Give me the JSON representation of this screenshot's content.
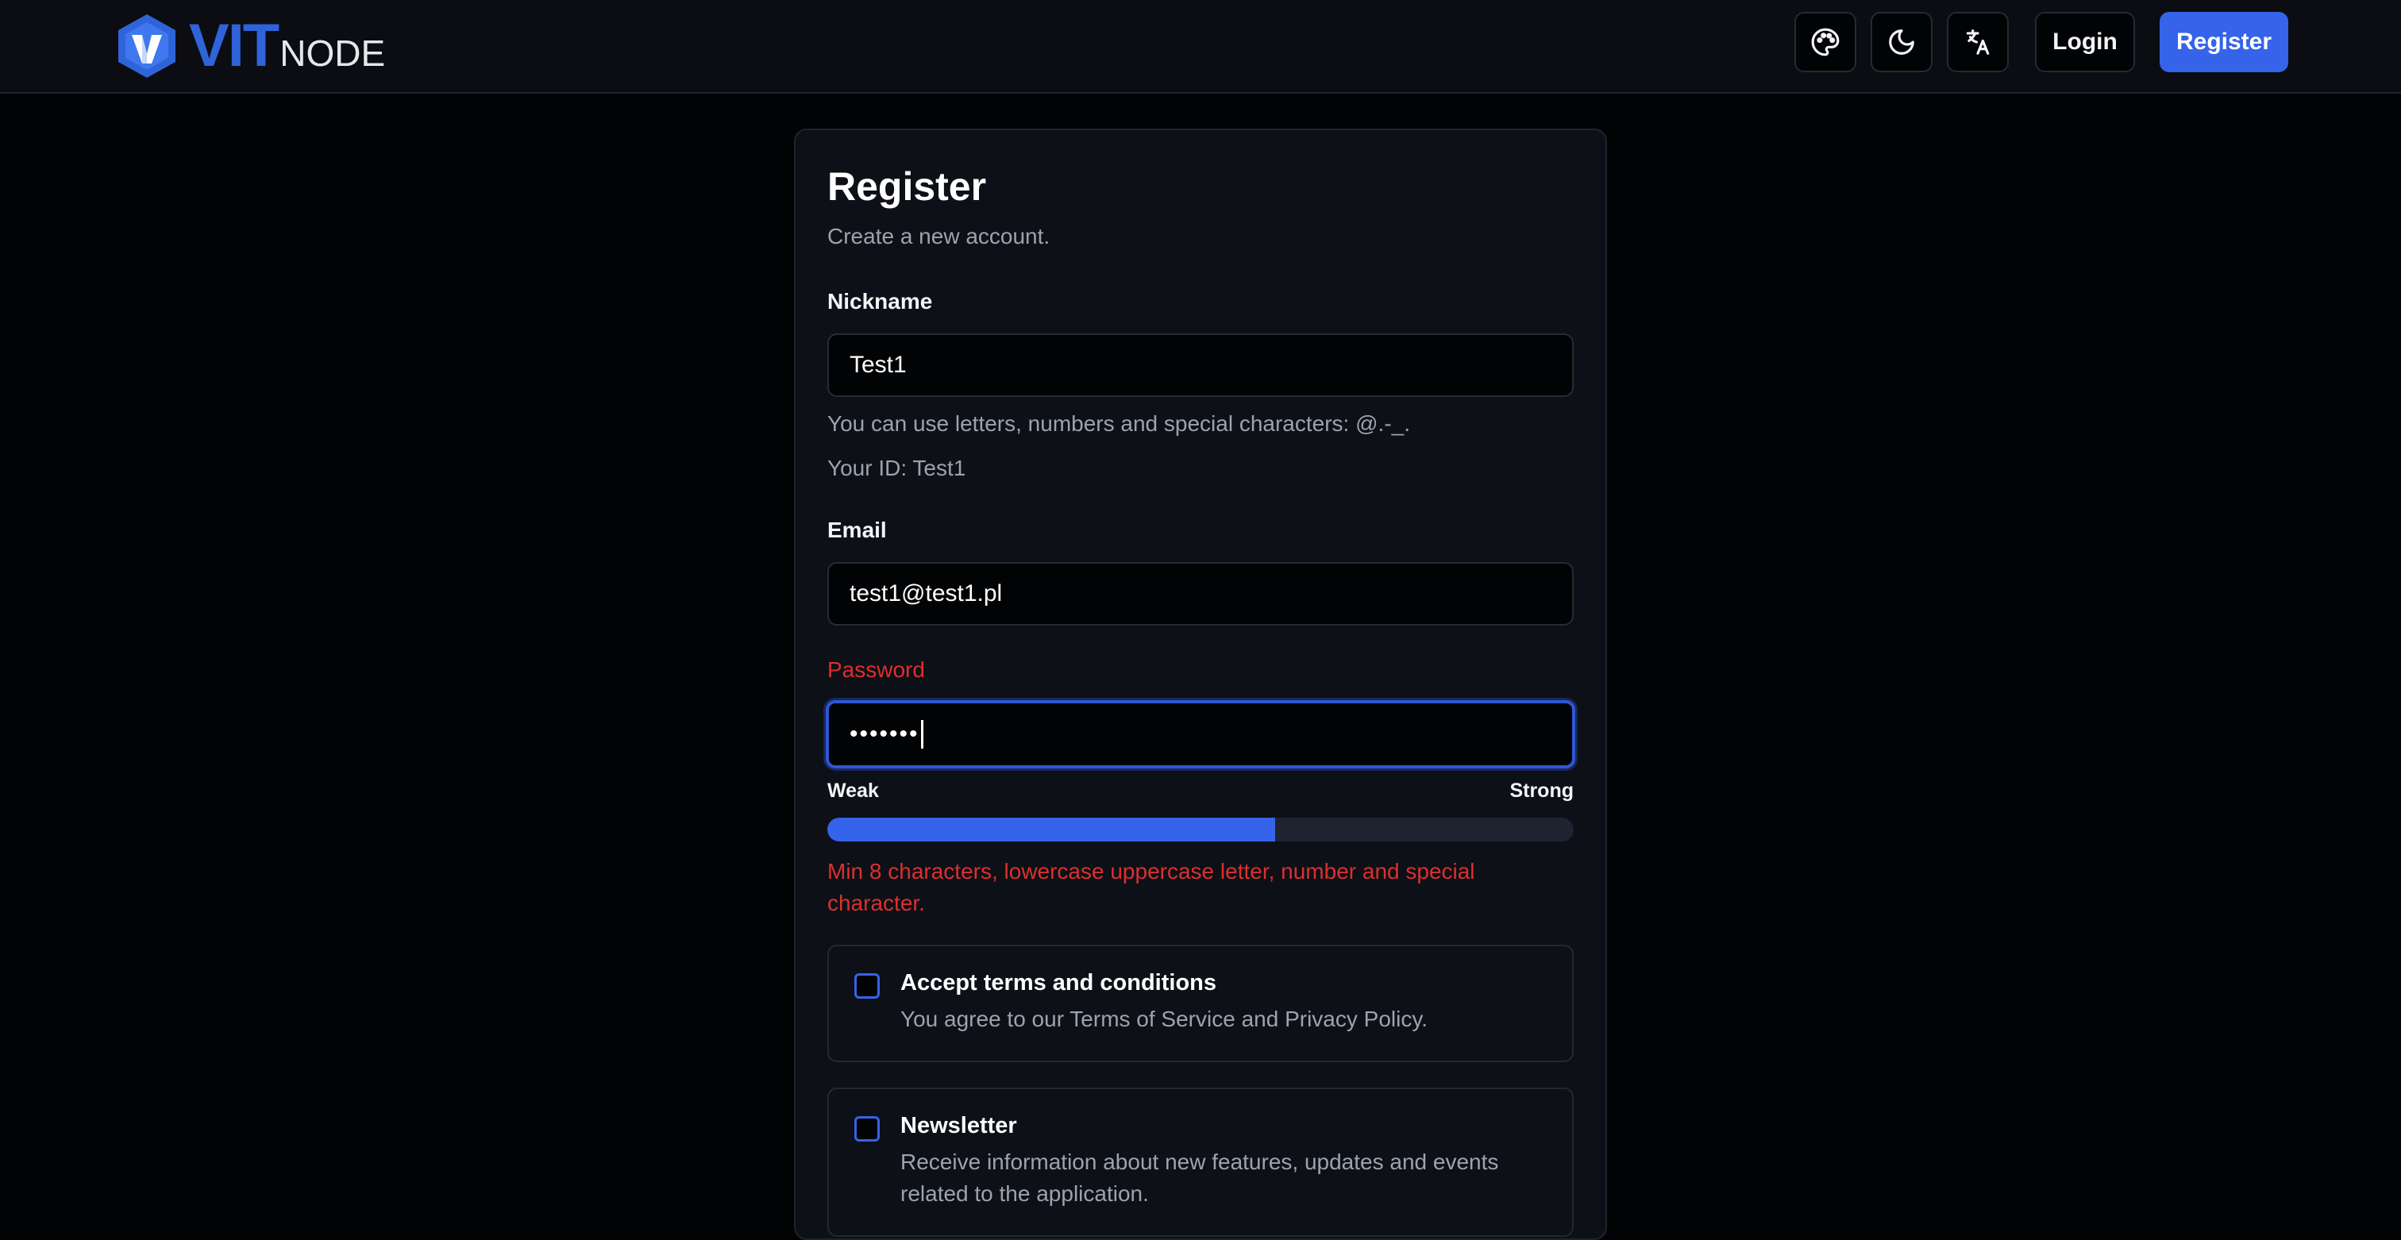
{
  "brand": {
    "logo_primary": "VIT",
    "logo_secondary": "NODE"
  },
  "header": {
    "theme_icon": "palette-icon",
    "mode_icon": "moon-icon",
    "language_icon": "translate-icon",
    "login_label": "Login",
    "register_label": "Register"
  },
  "form": {
    "title": "Register",
    "subtitle": "Create a new account.",
    "nickname": {
      "label": "Nickname",
      "value": "Test1",
      "hint": "You can use letters, numbers and special characters: @.-_.",
      "id_text": "Your ID: Test1"
    },
    "email": {
      "label": "Email",
      "value": "test1@test1.pl"
    },
    "password": {
      "label": "Password",
      "value_masked": "•••••••",
      "strength_weak_label": "Weak",
      "strength_strong_label": "Strong",
      "strength_percent": 60,
      "error": "Min 8 characters, lowercase uppercase letter, number and special character."
    },
    "terms": {
      "title": "Accept terms and conditions",
      "description": "You agree to our Terms of Service and Privacy Policy.",
      "checked": false
    },
    "newsletter": {
      "title": "Newsletter",
      "description": "Receive information about new features, updates and events related to the application.",
      "checked": false
    }
  },
  "colors": {
    "accent": "#3563e9",
    "error": "#dc2f2f",
    "background": "#020305",
    "card": "#0d1016",
    "muted_text": "#9ca3af"
  }
}
